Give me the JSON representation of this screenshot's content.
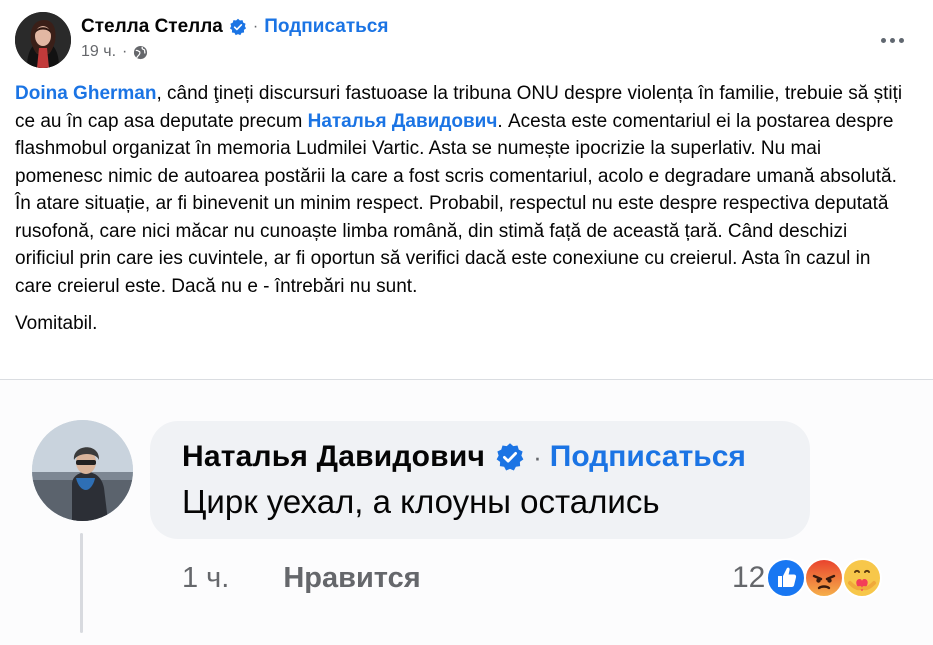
{
  "post": {
    "author": "Стелла Стелла",
    "follow_label": "Подписаться",
    "separator": "·",
    "time": "19 ч.",
    "meta_separator": "·",
    "body": {
      "p1_mention1": "Doina Gherman",
      "p1_text1": ", când ţineți discursuri fastuoase la tribuna ONU despre violența în familie, trebuie să știți ce au în cap asa deputate precum ",
      "p1_mention2": "Наталья Давидович",
      "p1_text2": ". Acesta este comentariul ei la postarea despre flashmobul organizat în memoria Ludmilei Vartic. Asta se numește ipocrizie la superlativ. Nu mai pomenesc nimic de autoarea postării la care a fost scris comentariul, acolo e degradare umană absolută.",
      "p2": "În atare situație, ar fi binevenit un minim respect. Probabil, respectul nu este despre  respectiva deputată rusofonă, care nici măcar nu cunoaște limba română, din stimă față de această țară. Când deschizi orificiul prin care ies cuvintele, ar fi oportun să verifici dacă este conexiune cu creierul. Asta în cazul in care creierul este. Dacă nu e - întrebări nu sunt.",
      "p3": "Vomitabil."
    }
  },
  "comment": {
    "author": "Наталья Давидович",
    "separator": "·",
    "follow_label": "Подписаться",
    "text": "Цирк уехал, а клоуны остались",
    "time": "1 ч.",
    "like_label": "Нравится",
    "reaction_count": "12",
    "reactions": [
      "like-icon",
      "angry-icon",
      "care-icon"
    ]
  },
  "colors": {
    "link": "#1b74e4",
    "text": "#050505",
    "secondary": "#65676b",
    "bubble": "#f0f2f5"
  }
}
